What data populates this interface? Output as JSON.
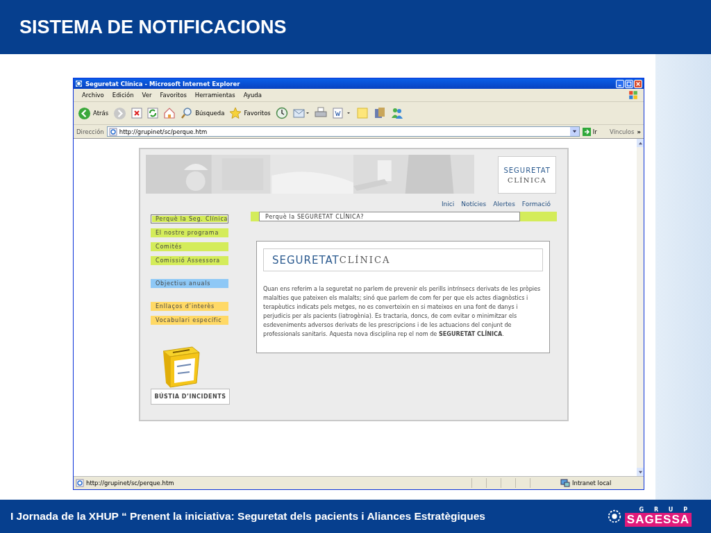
{
  "slide": {
    "title": "SISTEMA DE NOTIFICACIONS",
    "footer": "I Jornada de la XHUP “ Prenent la iniciativa: Seguretat dels pacients i Aliances Estratègiques",
    "logo_top": "G R U P",
    "logo_name": "SAGESSA"
  },
  "browser": {
    "title": "Seguretat Clínica - Microsoft Internet Explorer",
    "menu": [
      "Archivo",
      "Edición",
      "Ver",
      "Favoritos",
      "Herramientas",
      "Ayuda"
    ],
    "toolbar": [
      {
        "kind": "back",
        "label": "Atrás"
      },
      {
        "kind": "forward"
      },
      {
        "kind": "stop"
      },
      {
        "kind": "refresh"
      },
      {
        "kind": "home"
      },
      {
        "kind": "search",
        "label": "Búsqueda"
      },
      {
        "kind": "favorites",
        "label": "Favoritos"
      },
      {
        "kind": "history"
      },
      {
        "kind": "mail"
      },
      {
        "kind": "print"
      },
      {
        "kind": "edit"
      },
      {
        "kind": "notes"
      },
      {
        "kind": "research"
      },
      {
        "kind": "messenger"
      }
    ],
    "address_label": "Dirección",
    "address": "http://grupinet/sc/perque.htm",
    "go": "Ir",
    "links": "Vínculos",
    "links_more": "»",
    "status_url": "http://grupinet/sc/perque.htm",
    "zone": "Intranet local"
  },
  "page": {
    "logo": [
      "SEGURETAT",
      "CLÍNICA"
    ],
    "nav": [
      "Inici",
      "Notícies",
      "Alertes",
      "Formació"
    ],
    "menu_groups": [
      [
        {
          "label": "Perquè la Seg. Clínica",
          "color": "#d4ec5a",
          "selected": true
        },
        {
          "label": "El nostre programa",
          "color": "#d4ec5a",
          "selected": false
        },
        {
          "label": "Comités",
          "color": "#d4ec5a",
          "selected": false
        },
        {
          "label": "Comissió Assessora",
          "color": "#d4ec5a",
          "selected": false
        }
      ],
      [
        {
          "label": "Objectius anuals",
          "color": "#8ec8f6",
          "selected": false
        }
      ],
      [
        {
          "label": "Enllaços d’interès",
          "color": "#ffd966",
          "selected": false
        },
        {
          "label": "Vocabulari específic",
          "color": "#ffd966",
          "selected": false
        }
      ]
    ],
    "heading": "Perquè la SEGURETAT CLÍNICA?",
    "content_logo": [
      "SEGURETAT",
      "CLÍNICA"
    ],
    "body": "Quan ens referim a la seguretat no parlem de prevenir els perills intrínsecs derivats de les pròpies malalties que pateixen els malalts; sinó que parlem de com fer per que els actes diagnòstics i terapèutics indicats pels metges, no es converteixin en si mateixos en una font de danys i perjudicis per als pacients (iatrogènia). Es tractaria, doncs, de com evitar o minimitzar els esdeveniments adversos derivats de les prescripcions i de les actuacions del conjunt de professionals sanitaris. Aquesta nova disciplina rep el nom de **SEGURETAT CLÍNICA**.",
    "mailbox_label": "BÚSTIA D’INCIDENTS"
  }
}
